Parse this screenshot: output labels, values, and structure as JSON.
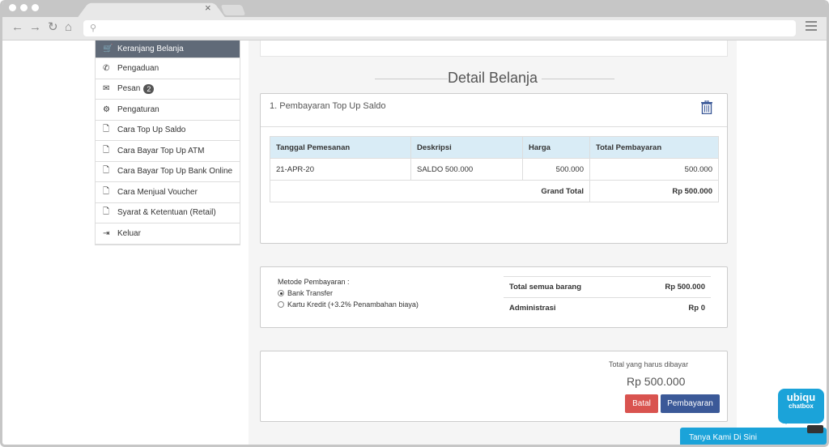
{
  "browser": {
    "tab_close": "×"
  },
  "sidebar": {
    "items": [
      {
        "label": "Keranjang Belanja",
        "icon": "cart-icon",
        "glyph": "🛒",
        "active": true
      },
      {
        "label": "Pengaduan",
        "icon": "phone-icon",
        "glyph": "✆"
      },
      {
        "label": "Pesan",
        "icon": "envelope-icon",
        "glyph": "✉",
        "badge": "2"
      },
      {
        "label": "Pengaturan",
        "icon": "gear-icon",
        "glyph": "⚙"
      },
      {
        "label": "Cara Top Up Saldo",
        "icon": "document-icon",
        "glyph": "🗋"
      },
      {
        "label": "Cara Bayar Top Up ATM",
        "icon": "document-icon",
        "glyph": "🗋"
      },
      {
        "label": "Cara Bayar Top Up Bank Online",
        "icon": "document-icon",
        "glyph": "🗋"
      },
      {
        "label": "Cara Menjual Voucher",
        "icon": "document-icon",
        "glyph": "🗋"
      },
      {
        "label": "Syarat & Ketentuan (Retail)",
        "icon": "document-icon",
        "glyph": "🗋"
      },
      {
        "label": "Keluar",
        "icon": "logout-icon",
        "glyph": "⇥"
      }
    ]
  },
  "main": {
    "section_title": "Detail Belanja",
    "order": {
      "title": "1. Pembayaran Top Up Saldo",
      "table": {
        "headers": [
          "Tanggal Pemesanan",
          "Deskripsi",
          "Harga",
          "Total Pembayaran"
        ],
        "rows": [
          [
            "21-APR-20",
            "SALDO 500.000",
            "500.000",
            "500.000"
          ]
        ],
        "grand_total_label": "Grand Total",
        "grand_total_value": "Rp 500.000"
      }
    },
    "payment": {
      "method_label": "Metode Pembayaran :",
      "options": [
        {
          "label": "Bank Transfer",
          "selected": true
        },
        {
          "label": "Kartu Kredit (+3.2% Penambahan biaya)",
          "selected": false
        }
      ],
      "summary": [
        {
          "label": "Total semua barang",
          "value": "Rp 500.000"
        },
        {
          "label": "Administrasi",
          "value": "Rp 0"
        }
      ]
    },
    "checkout": {
      "total_label": "Total yang harus dibayar",
      "total_value": "Rp 500.000",
      "cancel_label": "Batal",
      "pay_label": "Pembayaran"
    }
  },
  "chat": {
    "logo_line1": "ubiqu",
    "logo_line2": "chatbox",
    "bar_label": "Tanya Kami Di Sini"
  },
  "colors": {
    "sidebar_active": "#606a78",
    "table_header": "#d9ecf6",
    "cancel_button": "#d9534f",
    "pay_button": "#3b5998",
    "chat": "#1ba3d9"
  }
}
